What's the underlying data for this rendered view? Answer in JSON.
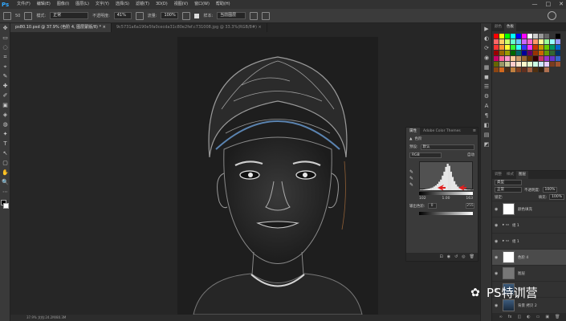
{
  "app": {
    "logo": "Ps",
    "window_controls": [
      "—",
      "□",
      "✕"
    ]
  },
  "menu": [
    "文件(F)",
    "编辑(E)",
    "图像(I)",
    "图层(L)",
    "文字(Y)",
    "选择(S)",
    "滤镜(T)",
    "3D(D)",
    "视图(V)",
    "窗口(W)",
    "帮助(H)"
  ],
  "options": {
    "size_value": "50",
    "mode_label": "模式:",
    "mode_value": "正常",
    "opacity_label": "不透明度:",
    "opacity_value": "41%",
    "flow_label": "流量:",
    "flow_value": "100%",
    "sample_label": "样本:",
    "sample_value": "当前图层"
  },
  "tabs": [
    {
      "label": "ps80.10.psd @ 37.9% (色阶 4, 图层蒙版/8) * ×",
      "active": true
    },
    {
      "label": "9c5731a6a190e5fa0cecda31c80e2fef.c731008.jpg @ 33.3%(RGB/8#) ×",
      "active": false
    }
  ],
  "toolbar": [
    "✥",
    "▭",
    "◌",
    "⌗",
    "⌖",
    "✎",
    "✚",
    "✐",
    "▣",
    "◈",
    "◍",
    "✦",
    "T",
    "↖",
    "▢",
    "✋",
    "🔍",
    "⋯"
  ],
  "statusbar": "37.9%    文档:24.2M/80.3M",
  "icon_strip": [
    "▶",
    "◐",
    "⟳",
    "◉",
    "▦",
    "◼",
    "☰",
    "⚙",
    "A",
    "¶",
    "◧",
    "▤",
    "◩"
  ],
  "right_panel": {
    "tabs": [
      {
        "label": "颜色",
        "active": false
      },
      {
        "label": "色板",
        "active": true
      }
    ],
    "swatches": [
      "#ff0000",
      "#ffff00",
      "#00ff00",
      "#00ffff",
      "#0000ff",
      "#ff00ff",
      "#ffffff",
      "#cccccc",
      "#999999",
      "#666666",
      "#333333",
      "#000000",
      "#ff6666",
      "#ffcc66",
      "#ccff66",
      "#66ffcc",
      "#66ccff",
      "#cc66ff",
      "#ff66cc",
      "#ff9966",
      "#ffff99",
      "#99ff99",
      "#99ffff",
      "#9999ff",
      "#ff3333",
      "#ff9933",
      "#ffff33",
      "#33ff33",
      "#33ffff",
      "#3333ff",
      "#ff33ff",
      "#cc3300",
      "#cc9900",
      "#66cc00",
      "#009966",
      "#0066cc",
      "#990000",
      "#996600",
      "#999900",
      "#006600",
      "#006666",
      "#000099",
      "#660066",
      "#993300",
      "#cc6600",
      "#669900",
      "#336633",
      "#003366",
      "#cc0066",
      "#ff6699",
      "#ff99cc",
      "#ffcc99",
      "#cc9966",
      "#996633",
      "#663300",
      "#330000",
      "#cc3366",
      "#9933cc",
      "#6633cc",
      "#3366cc",
      "#666600",
      "#999966",
      "#cccc99",
      "#ffcccc",
      "#ffe5cc",
      "#fffacc",
      "#e5ffcc",
      "#ccffe5",
      "#cce5ff",
      "#e5ccff",
      "#7a3d1f",
      "#a0522d",
      "#8b4513",
      "#d2691e",
      "#4b2e17",
      "#c08040",
      "#804020",
      "#603020",
      "#a06040",
      "#503010",
      "#302010",
      "#b07050"
    ]
  },
  "layers": {
    "tabs": [
      {
        "label": "调整",
        "active": false
      },
      {
        "label": "样式",
        "active": false
      },
      {
        "label": "图层",
        "active": true
      }
    ],
    "filter_label": "类型",
    "blend_value": "正常",
    "opacity_label": "不透明度:",
    "opacity_value": "100%",
    "lock_label": "锁定:",
    "fill_label": "填充:",
    "fill_value": "100%",
    "items": [
      {
        "name": "颜色填充",
        "thumb": "white",
        "selected": false
      },
      {
        "name": "组 1",
        "thumb": "none",
        "selected": false
      },
      {
        "name": "组 1",
        "thumb": "none",
        "selected": false
      },
      {
        "name": "色阶 4",
        "thumb": "white",
        "selected": true
      },
      {
        "name": "图层",
        "thumb": "gray",
        "selected": false
      },
      {
        "name": "照片",
        "thumb": "photo",
        "selected": false
      },
      {
        "name": "背景 拷贝 2",
        "thumb": "photo",
        "selected": false
      }
    ],
    "footer_icons": [
      "∞",
      "fx",
      "◫",
      "◐",
      "▭",
      "▣",
      "🗑"
    ]
  },
  "properties": {
    "tabs": [
      {
        "label": "属性",
        "active": true
      },
      {
        "label": "Adobe Color Themes",
        "active": false
      }
    ],
    "title": "色阶",
    "preset_label": "预设:",
    "preset_value": "默认",
    "channel_value": "RGB",
    "auto_label": "自动",
    "input_black": "102",
    "input_mid": "1.00",
    "input_white": "163",
    "output_label": "输出色阶:",
    "output_black": "0",
    "output_white": "255",
    "footer_icons": [
      "⊡",
      "◉",
      "↺",
      "◎",
      "🗑"
    ],
    "histogram": [
      2,
      2,
      3,
      4,
      5,
      6,
      8,
      10,
      14,
      18,
      24,
      32,
      40,
      55,
      70,
      88,
      100,
      92,
      70,
      50,
      34,
      22,
      14,
      10,
      7,
      5,
      4,
      3,
      2,
      2,
      1,
      1
    ]
  },
  "watermark": {
    "text": "PS特训营"
  }
}
